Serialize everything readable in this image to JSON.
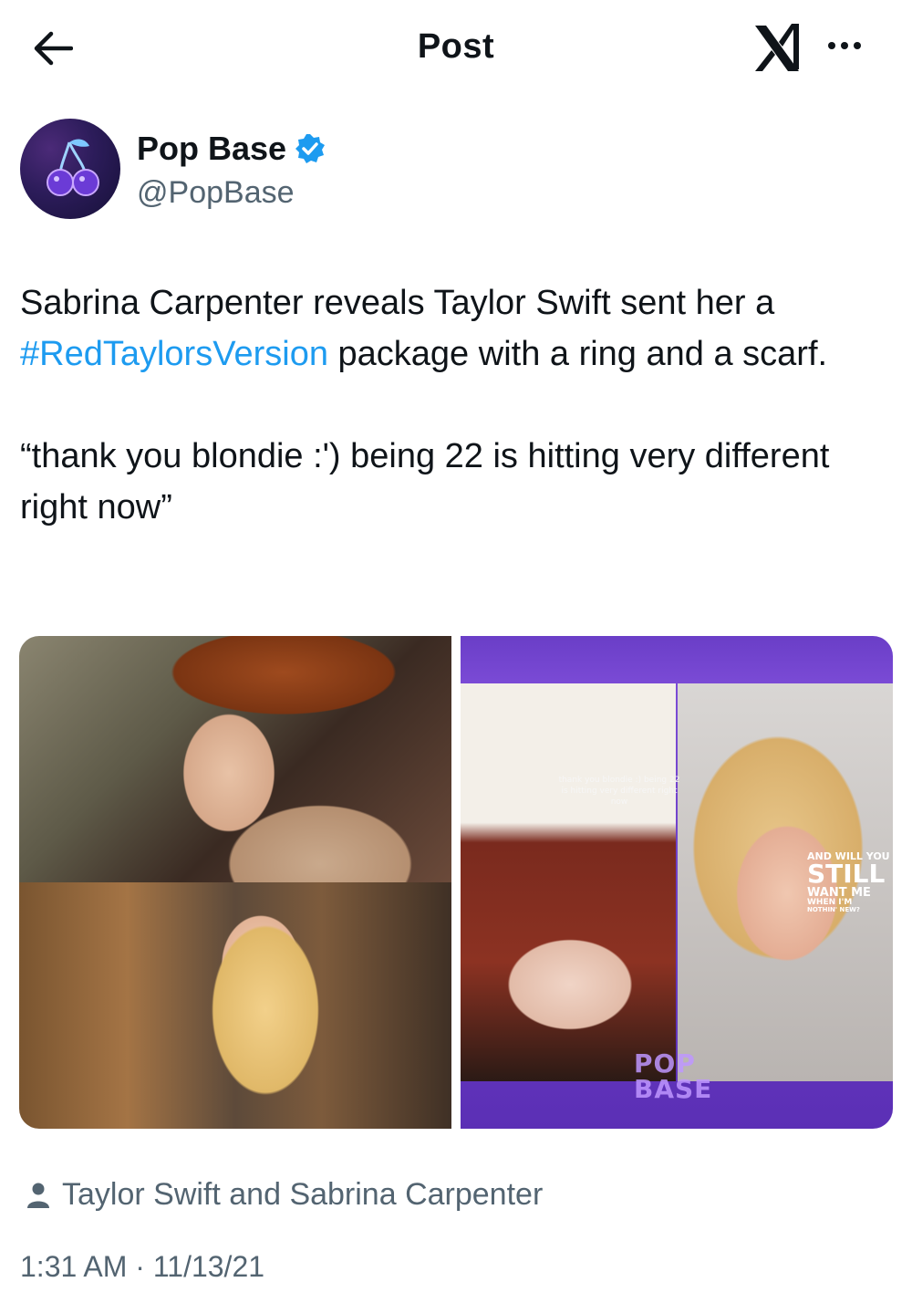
{
  "header": {
    "title": "Post",
    "back_icon": "arrow-left-icon",
    "logo_icon": "x-logo-icon",
    "more_icon": "more-horizontal-icon"
  },
  "author": {
    "display_name": "Pop Base",
    "handle": "@PopBase",
    "verified": true,
    "verified_color": "#1d9bf0"
  },
  "post": {
    "text_line1": "Sabrina Carpenter reveals Taylor Swift sent her a",
    "hashtag": "#RedTaylorsVersion",
    "text_line2_rest": " package with a ring and a scarf.",
    "quote": "“thank you blondie :') being 22 is hitting very different right now”",
    "link_color": "#1d9bf0"
  },
  "media": {
    "story_caption": "thank you blondie :) being 22 is hitting very different right now",
    "overlay_line1": "AND WILL YOU",
    "overlay_line2": "STILL",
    "overlay_line3": "WANT ME",
    "overlay_line4": "WHEN I'M",
    "overlay_line5": "NOTHIN' NEW?",
    "watermark_line1": "POP",
    "watermark_line2": "BASE"
  },
  "tagged": {
    "icon": "person-icon",
    "text": "Taylor Swift and Sabrina Carpenter"
  },
  "meta": {
    "timestamp": "1:31 AM · 11/13/21"
  }
}
